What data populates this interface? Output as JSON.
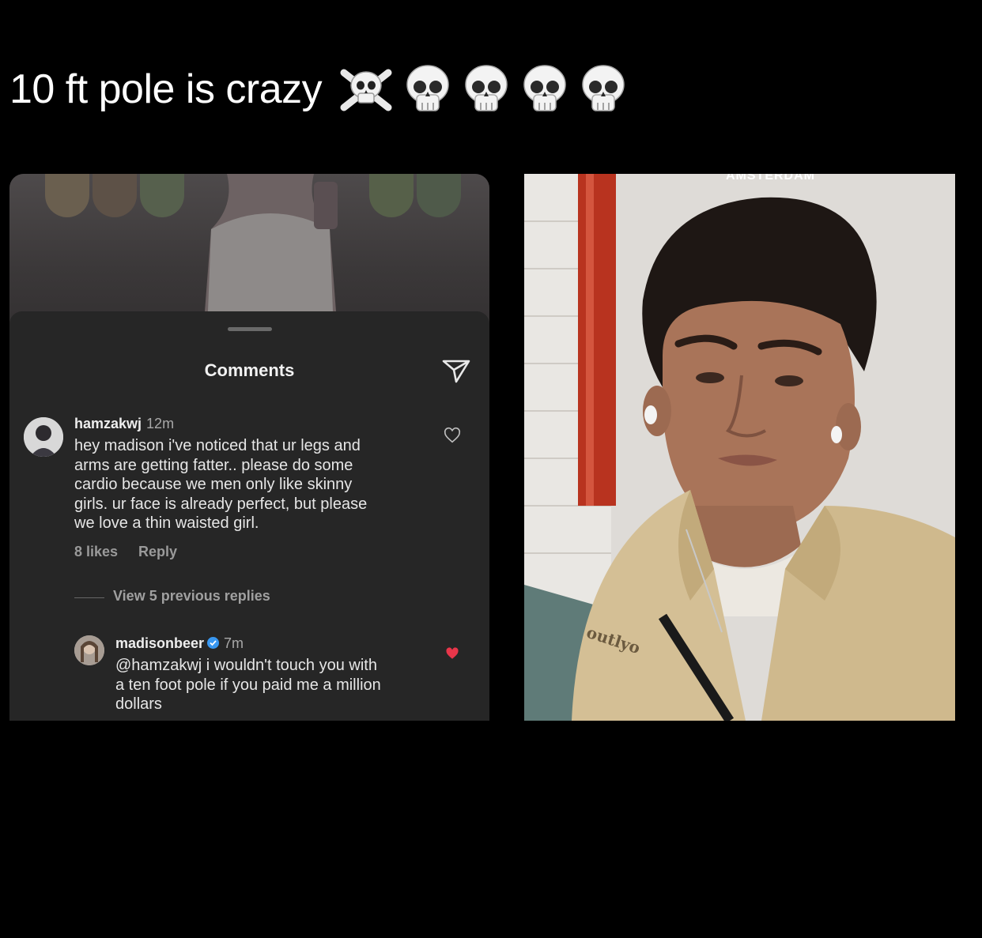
{
  "caption": {
    "text": "10 ft pole is crazy",
    "emoji": [
      "crossbones-icon",
      "skull-icon",
      "skull-icon",
      "skull-icon",
      "skull-icon"
    ]
  },
  "comments_sheet": {
    "title": "Comments",
    "comment": {
      "username": "hamzakwj",
      "time": "12m",
      "text": "hey madison i've noticed that ur legs and\narms are getting fatter.. please do some\ncardio because we men only like skinny\ngirls. ur face is already perfect, but please\nwe love a thin waisted girl.",
      "likes": "8 likes",
      "reply_label": "Reply",
      "liked": false
    },
    "view_replies": "View 5 previous replies",
    "reply": {
      "username": "madisonbeer",
      "verified": true,
      "time": "7m",
      "text": "@hamzakwj i wouldn't touch you with\na ten foot pole if you paid me a million\ndollars",
      "liked": true
    }
  },
  "photo": {
    "location_sticker": "AMSTERDAM",
    "jacket_logo": "outlyo"
  },
  "colors": {
    "background": "#000000",
    "sheet": "#262626",
    "heart_liked": "#e8364a",
    "verified": "#3897f0",
    "jacket": "#d4bf95"
  }
}
